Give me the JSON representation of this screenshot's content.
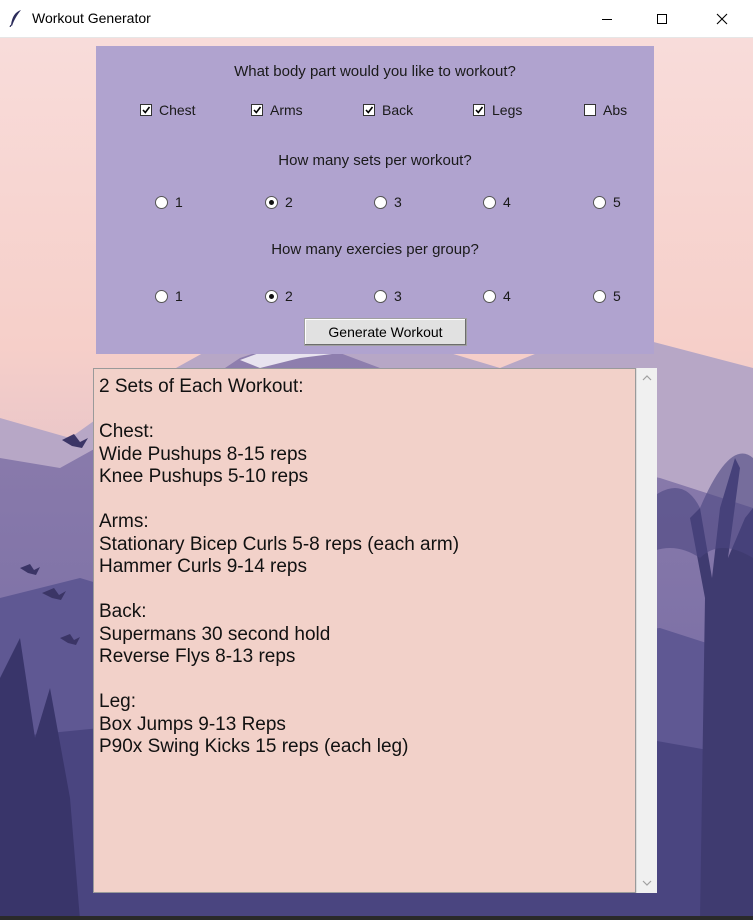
{
  "window": {
    "title": "Workout Generator",
    "icon": "feather-icon",
    "controls": [
      "minimize-icon",
      "maximize-icon",
      "close-icon"
    ]
  },
  "panel": {
    "background": "#b0a3cf",
    "body_question": "What body part would you like to workout?",
    "body_parts": [
      {
        "label": "Chest",
        "checked": true
      },
      {
        "label": "Arms",
        "checked": true
      },
      {
        "label": "Back",
        "checked": true
      },
      {
        "label": "Legs",
        "checked": true
      },
      {
        "label": "Abs",
        "checked": false
      }
    ],
    "sets_question": "How many sets per workout?",
    "sets_options": [
      "1",
      "2",
      "3",
      "4",
      "5"
    ],
    "sets_selected": "2",
    "exercises_question": "How many exercies per group?",
    "exercises_options": [
      "1",
      "2",
      "3",
      "4",
      "5"
    ],
    "exercises_selected": "2",
    "generate_label": "Generate Workout"
  },
  "output": {
    "background": "#f2d1c9",
    "lines": [
      "2 Sets of Each Workout:",
      "",
      "Chest:",
      "Wide Pushups 8-15 reps",
      "Knee Pushups 5-10 reps",
      "",
      "Arms:",
      "Stationary Bicep Curls 5-8 reps (each arm)",
      "Hammer Curls 9-14 reps",
      "",
      "Back:",
      "Supermans 30 second hold",
      "Reverse Flys 8-13 reps",
      "",
      "Leg:",
      "Box Jumps 9-13 Reps",
      "P90x Swing Kicks 15 reps (each leg)"
    ]
  }
}
